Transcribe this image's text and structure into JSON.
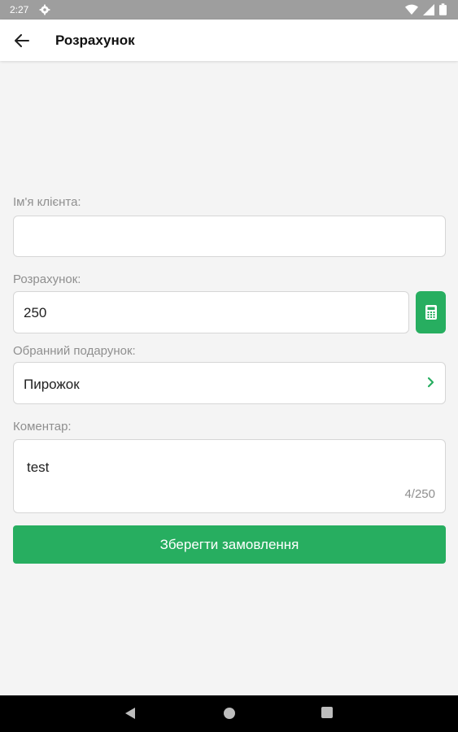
{
  "status_bar": {
    "time": "2:27"
  },
  "header": {
    "title": "Розрахунок"
  },
  "form": {
    "client_name": {
      "label": "Ім'я клієнта:",
      "value": ""
    },
    "amount": {
      "label": "Розрахунок:",
      "value": "250"
    },
    "gift": {
      "label": "Обранний подарунок:",
      "value": "Пирожок"
    },
    "comment": {
      "label": "Коментар:",
      "value": "test",
      "counter": "4/250"
    },
    "save_label": "Зберегти замовлення"
  },
  "colors": {
    "accent": "#27ae60",
    "status_bar": "#9e9e9e",
    "background": "#f4f4f4"
  },
  "icons": [
    "back-arrow-icon",
    "calculator-icon",
    "chevron-right-icon",
    "settings-icon",
    "wifi-icon",
    "battery-icon",
    "nav-back-icon",
    "nav-home-icon",
    "nav-recents-icon"
  ]
}
